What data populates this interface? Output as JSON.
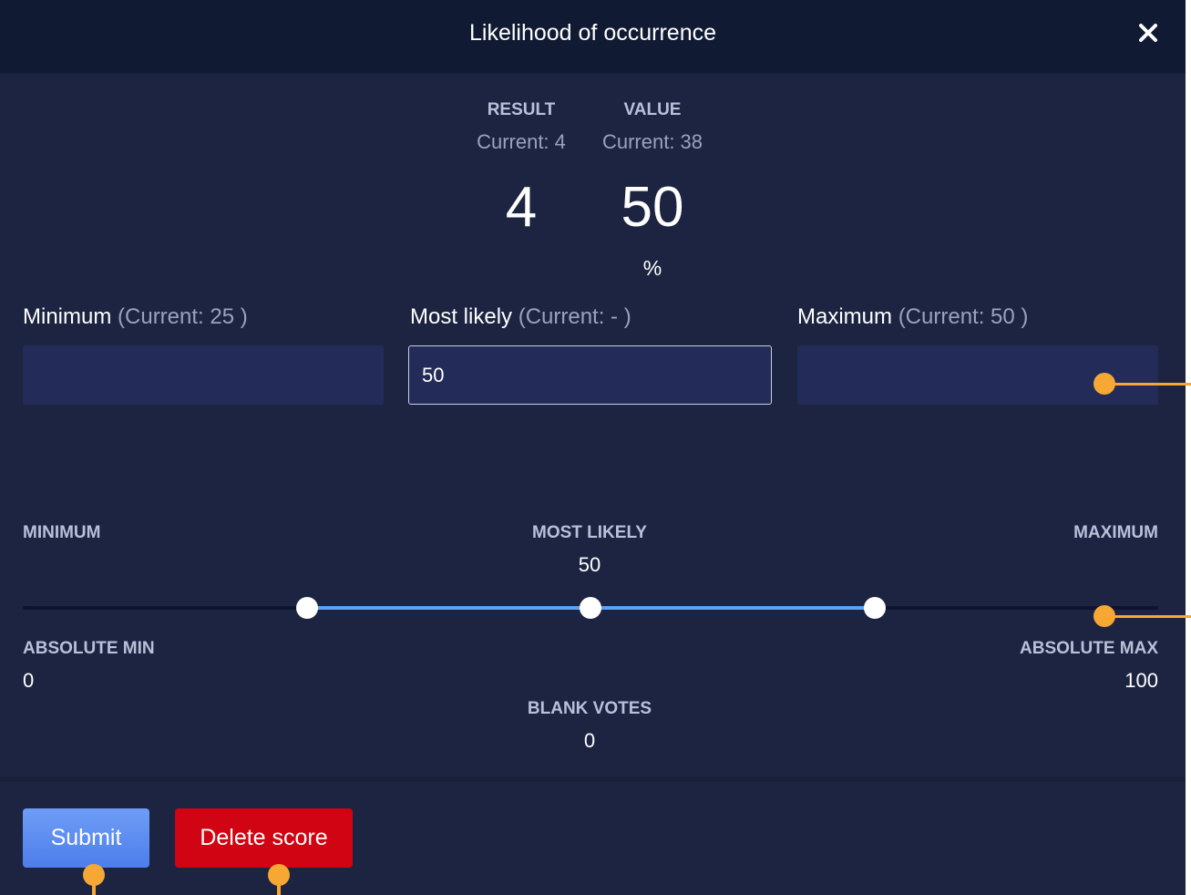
{
  "dialog": {
    "title": "Likelihood of occurrence",
    "close_icon": "close-icon"
  },
  "summary": {
    "result": {
      "label": "RESULT",
      "current": "Current: 4",
      "value": "4"
    },
    "value": {
      "label": "VALUE",
      "current": "Current: 38",
      "value": "50",
      "unit": "%"
    }
  },
  "fields": {
    "minimum": {
      "label": "Minimum",
      "current": "(Current: 25 )",
      "value": ""
    },
    "most_likely": {
      "label": "Most likely",
      "current": "(Current: - )",
      "value": "50"
    },
    "maximum": {
      "label": "Maximum",
      "current": "(Current: 50 )",
      "value": ""
    }
  },
  "slider": {
    "minimum_label": "MINIMUM",
    "most_likely_label": "MOST LIKELY",
    "most_likely_value": "50",
    "maximum_label": "MAXIMUM",
    "absolute_min_label": "ABSOLUTE MIN",
    "absolute_min_value": "0",
    "absolute_max_label": "ABSOLUTE MAX",
    "absolute_max_value": "100",
    "blank_votes_label": "BLANK VOTES",
    "blank_votes_value": "0",
    "handles": {
      "minimum": 25,
      "most_likely": 50,
      "maximum": 75
    },
    "range_min": 0,
    "range_max": 100
  },
  "footer": {
    "submit_label": "Submit",
    "delete_label": "Delete score"
  },
  "colors": {
    "modal_bg": "#1c2442",
    "header_bg": "#111a33",
    "slider_fill": "#5ba3f5",
    "submit": "#5b8cf0",
    "delete": "#d00412",
    "annotation": "#f7a733"
  }
}
